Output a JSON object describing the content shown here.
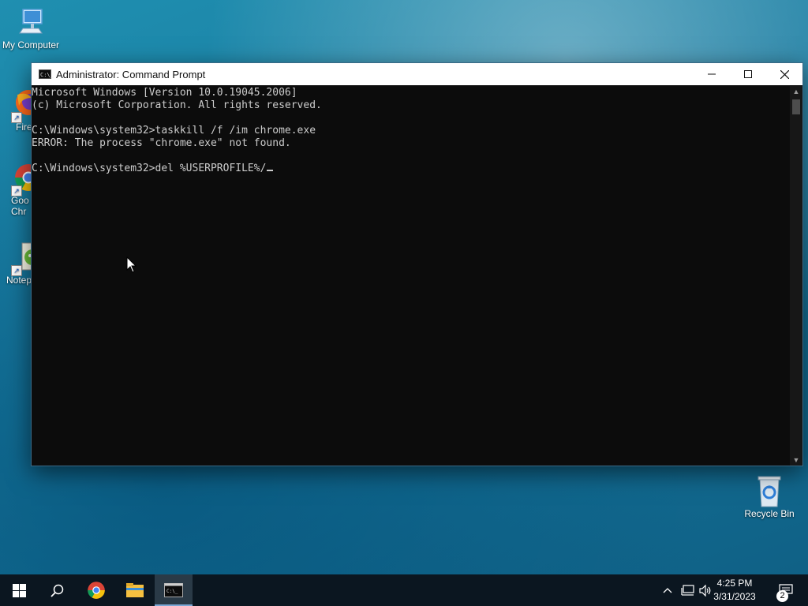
{
  "desktop": {
    "icons": [
      {
        "label": "My Computer"
      },
      {
        "label": "Fire"
      },
      {
        "label": "Goo\nChr"
      },
      {
        "label": "Notep"
      },
      {
        "label": "Recycle Bin"
      }
    ]
  },
  "window": {
    "title": "Administrator: Command Prompt",
    "icon": "cmd-icon",
    "controls": {
      "minimize": "minimize-icon",
      "maximize": "maximize-icon",
      "close": "close-icon"
    }
  },
  "console": {
    "lines": [
      "Microsoft Windows [Version 10.0.19045.2006]",
      "(c) Microsoft Corporation. All rights reserved.",
      "",
      "C:\\Windows\\system32>taskkill /f /im chrome.exe",
      "ERROR: The process \"chrome.exe\" not found.",
      "",
      "C:\\Windows\\system32>del %USERPROFILE%/"
    ]
  },
  "taskbar": {
    "items": [
      "start-icon",
      "search-icon",
      "chrome-icon",
      "file-explorer-icon",
      "cmd-icon"
    ],
    "active": "cmd-icon",
    "tray": [
      "chevron-up-icon",
      "network-icon",
      "volume-icon"
    ],
    "time": "4:25 PM",
    "date": "3/31/2023",
    "notifications": "2"
  },
  "colors": {
    "console_bg": "#0c0c0c",
    "console_text": "#cccccc",
    "taskbar_bg": "#0b1620",
    "accent": "#7aa7d4"
  }
}
